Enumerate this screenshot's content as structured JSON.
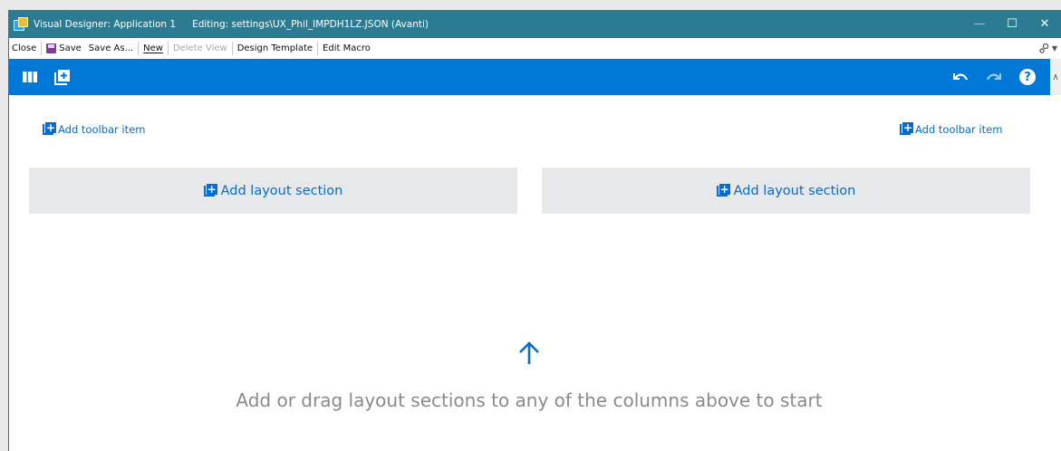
{
  "window": {
    "app_title": "Visual Designer: Application 1",
    "editing_title": "Editing: settings\\UX_Phil_IMPDH1LZ.JSON  (Avanti)",
    "controls": {
      "minimize": "—",
      "maximize": "☐",
      "close": "✕"
    }
  },
  "menu": {
    "close": "Close",
    "save": "Save",
    "save_as": "Save As...",
    "new": "New",
    "delete_view": "Delete View",
    "design_template": "Design Template",
    "edit_macro": "Edit Macro"
  },
  "toolbar": {
    "left_icons": [
      "columns-icon",
      "add-page-icon"
    ],
    "right_icons": [
      "undo-icon",
      "redo-icon",
      "help-icon"
    ],
    "help_glyph": "?",
    "accent": "#0078d7"
  },
  "content": {
    "add_toolbar_item_left": "Add toolbar item",
    "add_toolbar_item_right": "Add toolbar item",
    "add_layout_section_left": "Add layout section",
    "add_layout_section_right": "Add layout section",
    "hint": "Add or drag layout sections to any of the columns above to start"
  },
  "colors": {
    "titlebar": "#2b7b93",
    "link": "#0a6bc9",
    "section_bg": "#e6e8ea",
    "hint": "#8a8a8a"
  }
}
